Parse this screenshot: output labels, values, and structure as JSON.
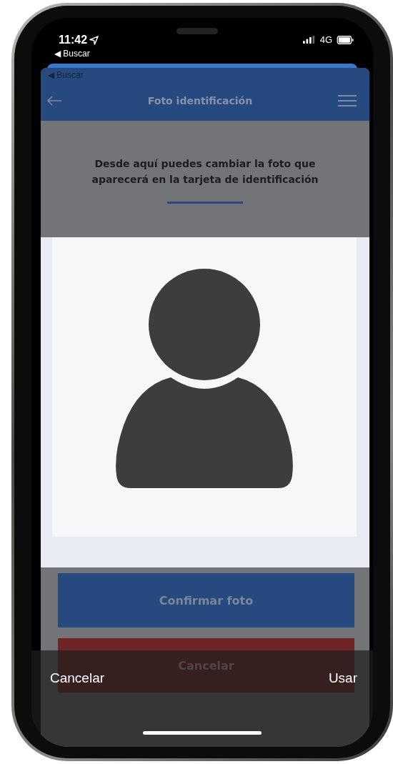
{
  "status_bar": {
    "time": "11:42",
    "network": "4G"
  },
  "back_link": "◀ Buscar",
  "app": {
    "back_link": "◀ Buscar",
    "title": "Foto identificación",
    "instruction": "Desde aquí puedes cambiar la foto que aparecerá en la tarjeta de identificación",
    "buttons": [
      {
        "label": "Confirmar foto",
        "kind": "primary"
      },
      {
        "label": "Cancelar",
        "kind": "danger"
      }
    ]
  },
  "picker_bar": {
    "cancel": "Cancelar",
    "use": "Usar"
  }
}
